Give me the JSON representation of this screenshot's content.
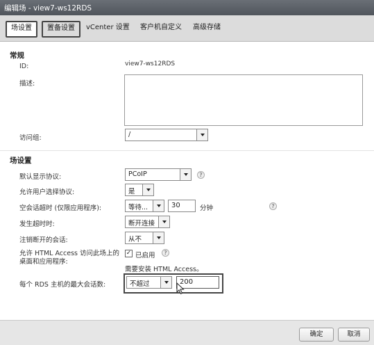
{
  "window": {
    "title": "编辑场 - view7-ws12RDS"
  },
  "tabs": [
    {
      "label": "场设置"
    },
    {
      "label": "置备设置"
    },
    {
      "label": "vCenter 设置"
    },
    {
      "label": "客户机自定义"
    },
    {
      "label": "高级存储"
    }
  ],
  "general": {
    "section_title": "常规",
    "id_label": "ID:",
    "id_value": "view7-ws12RDS",
    "description_label": "描述:",
    "description_value": "",
    "access_group_label": "访问组:",
    "access_group_value": "/"
  },
  "farm_settings": {
    "section_title": "场设置",
    "default_protocol_label": "默认显示协议:",
    "default_protocol_value": "PCoIP",
    "allow_user_choose_label": "允许用户选择协议:",
    "allow_user_choose_value": "是",
    "empty_session_timeout_label": "空会话超时 (仅限应用程序):",
    "empty_session_timeout_select": "等待...",
    "empty_session_timeout_value": "30",
    "empty_session_timeout_unit": "分钟",
    "on_timeout_label": "发生超时时:",
    "on_timeout_value": "断开连接",
    "logoff_disconnected_label": "注销断开的会话:",
    "logoff_disconnected_value": "从不",
    "html_access_label": "允许 HTML Access 访问此场上的桌面和应用程序:",
    "html_access_checked": true,
    "html_access_checkbox_label": "已启用",
    "html_access_note": "需要安装 HTML Access。",
    "max_sessions_label": "每个 RDS 主机的最大会话数:",
    "max_sessions_select": "不超过",
    "max_sessions_value": "200"
  },
  "footer": {
    "ok_label": "确定",
    "cancel_label": "取消"
  },
  "icons": {
    "help": "question-mark-icon",
    "dropdown": "chevron-down-icon"
  }
}
